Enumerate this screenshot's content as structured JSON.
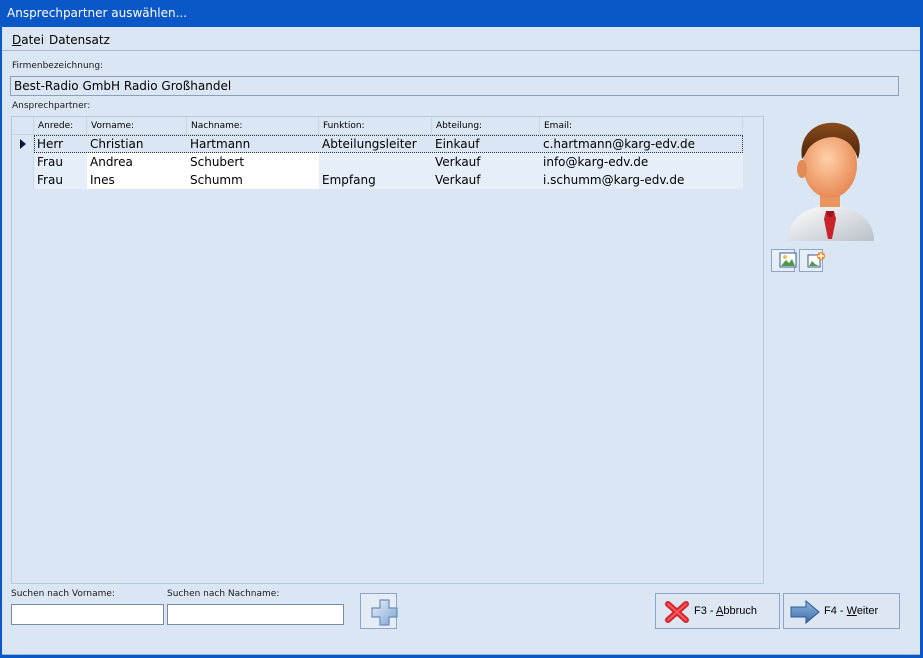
{
  "window": {
    "title": "Ansprechpartner auswählen..."
  },
  "menu": [
    {
      "label": "Datei",
      "accel": "D",
      "rest": "atei"
    },
    {
      "label": "Datensatz"
    }
  ],
  "company": {
    "label": "Firmenbezeichnung:",
    "value": "Best-Radio GmbH Radio Großhandel"
  },
  "contacts": {
    "label": "Ansprechpartner:",
    "columns": [
      "Anrede:",
      "Vorname:",
      "Nachname:",
      "Funktion:",
      "Abteilung:",
      "Email:"
    ],
    "rows": [
      [
        "Herr",
        "Christian",
        "Hartmann",
        "Abteilungsleiter",
        "Einkauf",
        "c.hartmann@karg-edv.de"
      ],
      [
        "Frau",
        "Andrea",
        "Schubert",
        "",
        "Verkauf",
        "info@karg-edv.de"
      ],
      [
        "Frau",
        "Ines",
        "Schumm",
        "Empfang",
        "Verkauf",
        "i.schumm@karg-edv.de"
      ]
    ]
  },
  "search": {
    "firstname_label": "Suchen nach Vorname:",
    "firstname_value": "",
    "lastname_label": "Suchen nach Nachname:",
    "lastname_value": ""
  },
  "buttons": {
    "cancel_prefix": "F3 - ",
    "cancel_accel": "A",
    "cancel_rest": "bbruch",
    "next_prefix": "F4 - ",
    "next_accel": "W",
    "next_rest": "eiter"
  },
  "icons": {
    "photo": "image-icon",
    "photo_edit": "edit-image-icon",
    "add": "plus-icon",
    "cancel": "red-x-icon",
    "next": "arrow-right-icon",
    "avatar": "person-avatar-icon"
  }
}
